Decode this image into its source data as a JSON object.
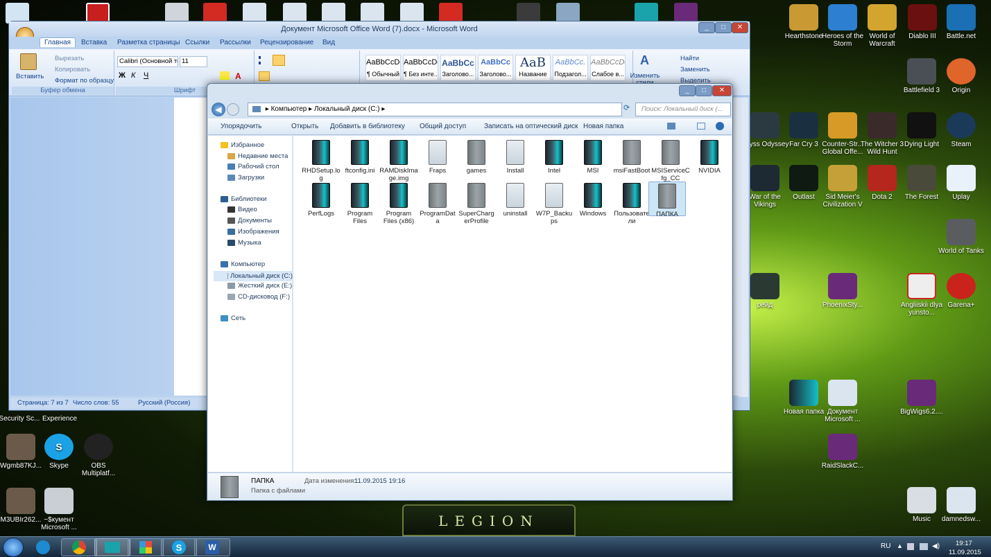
{
  "word": {
    "title": "Документ Microsoft Office Word (7).docx - Microsoft Word",
    "tabs": [
      "Главная",
      "Вставка",
      "Разметка страницы",
      "Ссылки",
      "Рассылки",
      "Рецензирование",
      "Вид"
    ],
    "clipboard": {
      "paste": "Вставить",
      "cut": "Вырезать",
      "copy": "Копировать",
      "format_painter": "Формат по образцу",
      "group": "Буфер обмена"
    },
    "font": {
      "name": "Calibri (Основной те",
      "size": "11",
      "group": "Шрифт"
    },
    "styles": [
      {
        "sample": "AaBbCcDc",
        "name": "¶ Обычный"
      },
      {
        "sample": "AaBbCcDc",
        "name": "¶ Без инте..."
      },
      {
        "sample": "AaBbCc",
        "name": "Заголово..."
      },
      {
        "sample": "AaBbCc",
        "name": "Заголово..."
      },
      {
        "sample": "AaB",
        "name": "Название"
      },
      {
        "sample": "AaBbCc.",
        "name": "Подзагол..."
      },
      {
        "sample": "AaBbCcDc",
        "name": "Слабое в..."
      }
    ],
    "change_styles": "Изменить стили",
    "editing": {
      "find": "Найти",
      "replace": "Заменить",
      "select": "Выделить"
    },
    "status": {
      "page": "Страница: 7 из 7",
      "words": "Число слов: 55",
      "lang": "Русский (Россия)"
    }
  },
  "explorer": {
    "breadcrumb": [
      "Компьютер",
      "Локальный диск (C:)"
    ],
    "search_placeholder": "Поиск: Локальный диск (...",
    "commands": [
      "Упорядочить",
      "Открыть",
      "Добавить в библиотеку",
      "Общий доступ",
      "Записать на оптический диск",
      "Новая папка"
    ],
    "nav": {
      "favorites": "Избранное",
      "fav_items": [
        "Недавние места",
        "Рабочий стол",
        "Загрузки"
      ],
      "libraries": "Библиотеки",
      "lib_items": [
        "Видео",
        "Документы",
        "Изображения",
        "Музыка"
      ],
      "computer": "Компьютер",
      "comp_items": [
        "Локальный диск (C:)",
        "Жесткий диск (E:)",
        "CD-дисковод (F:)"
      ],
      "network": "Сеть"
    },
    "files": [
      "RHDSetup.log",
      "ftconfig.ini",
      "RAMDiskImage.img",
      "Fraps",
      "games",
      "Install",
      "Intel",
      "MSI",
      "msiFastBoot",
      "MSIServiceCfg_CC",
      "NVIDIA",
      "PerfLogs",
      "Program Files",
      "Program Files (x86)",
      "ProgramData",
      "SuperChargerProfile",
      "uninstall",
      "W7P_Backups",
      "Windows",
      "Пользователи",
      "ПАПКА"
    ],
    "details": {
      "name": "ПАПКА",
      "type": "Папка с файлами",
      "modified_label": "Дата изменения:",
      "modified": "11.09.2015 19:16"
    }
  },
  "desktop": {
    "right": [
      "Hearthstone",
      "Heroes of the Storm",
      "World of Warcraft",
      "Diablo III",
      "Battle.net",
      "Battlefield 3",
      "Origin",
      "Abyss Odyssey",
      "Far Cry 3",
      "Counter-Str... Global Offe...",
      "The Witcher 3 Wild Hunt",
      "Dying Light",
      "Steam",
      "War of the Vikings",
      "Outlast",
      "Sid Meier's Civilization V",
      "Dota 2",
      "The Forest",
      "Uplay",
      "World of Tanks",
      "рейд",
      "PhoenixSty...",
      "Angliiskii dlya yunsto...",
      "Garena+",
      "Новая папка",
      "Документ Microsoft ...",
      "BigWigs6.2....",
      "RaidSlackC...",
      "Music",
      "damnedsw..."
    ],
    "left": [
      "Security Sc...",
      "Experience",
      "Wgmb87KJ...",
      "Skype",
      "OBS Multiplatf...",
      "M3UBIr262...",
      "~$кумент Microsoft ..."
    ]
  },
  "taskbar": {
    "lang": "RU",
    "time": "19:17",
    "date": "11.09.2015"
  },
  "banner": "LEGION"
}
